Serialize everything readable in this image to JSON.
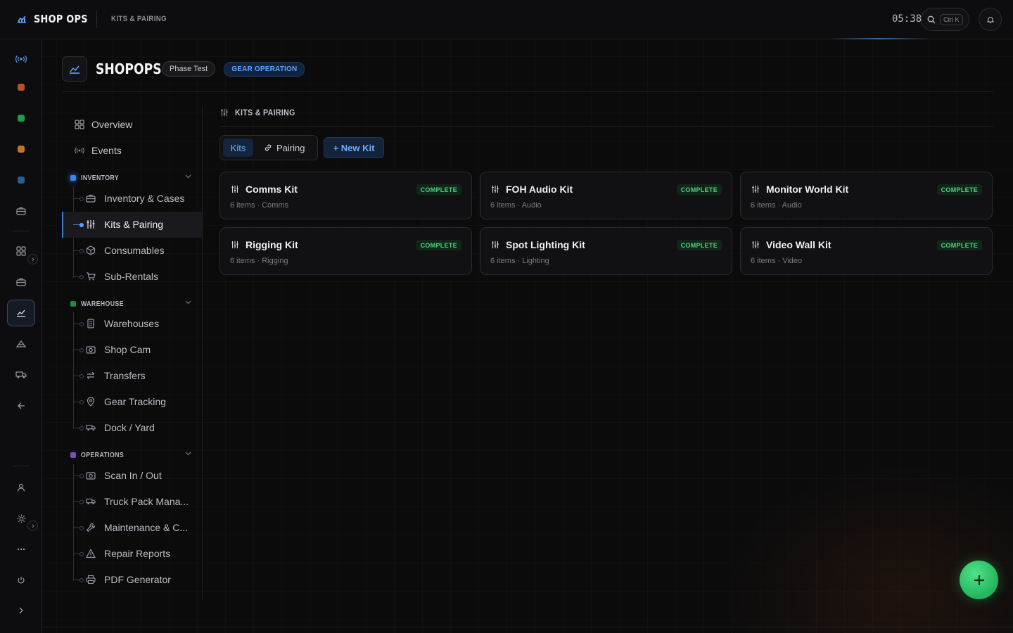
{
  "app": {
    "brand": "SHOP OPS",
    "breadcrumb": "KITS & PAIRING",
    "clock": "05:38",
    "search_shortcut": "Ctrl K"
  },
  "colors": {
    "accent": "#5da3ff",
    "complete": "#4fd27a",
    "fab": "#2fc56a",
    "inventory": "#3b82f6",
    "warehouse": "#22c55e",
    "operations": "#8b5cf6"
  },
  "rail": {
    "icons": [
      "broadcast-icon",
      "orange-dot-icon",
      "green-dot-icon",
      "amber-dot-icon",
      "blue-dot-icon",
      "briefcase-icon",
      "grid-icon",
      "briefcase-icon",
      "chart-icon",
      "tent-icon",
      "truck-icon",
      "back-arrow-icon",
      "user-icon",
      "sun-icon",
      "more-icon",
      "power-icon",
      "chevron-right-icon"
    ]
  },
  "header": {
    "title": "SHOPOPS",
    "phase_chip": "Phase Test",
    "mode_chip": "GEAR OPERATION"
  },
  "nav": {
    "overview": "Overview",
    "events": "Events",
    "groups": [
      {
        "label": "INVENTORY",
        "items": [
          "Inventory & Cases",
          "Kits & Pairing",
          "Consumables",
          "Sub-Rentals"
        ]
      },
      {
        "label": "WAREHOUSE",
        "items": [
          "Warehouses",
          "Shop Cam",
          "Transfers",
          "Gear Tracking",
          "Dock / Yard"
        ]
      },
      {
        "label": "OPERATIONS",
        "items": [
          "Scan In / Out",
          "Truck Pack Mana...",
          "Maintenance & C...",
          "Repair Reports",
          "PDF Generator"
        ]
      }
    ]
  },
  "main": {
    "section_title": "KITS & PAIRING",
    "tabs": {
      "kits": "Kits",
      "pairing": "Pairing"
    },
    "new_kit": "+ New Kit",
    "kits": [
      {
        "name": "Comms Kit",
        "meta": "6 items · Comms",
        "status": "COMPLETE"
      },
      {
        "name": "FOH Audio Kit",
        "meta": "6 items · Audio",
        "status": "COMPLETE"
      },
      {
        "name": "Monitor World Kit",
        "meta": "6 items · Audio",
        "status": "COMPLETE"
      },
      {
        "name": "Rigging Kit",
        "meta": "6 items · Rigging",
        "status": "COMPLETE"
      },
      {
        "name": "Spot Lighting Kit",
        "meta": "6 items · Lighting",
        "status": "COMPLETE"
      },
      {
        "name": "Video Wall Kit",
        "meta": "6 items · Video",
        "status": "COMPLETE"
      }
    ]
  }
}
